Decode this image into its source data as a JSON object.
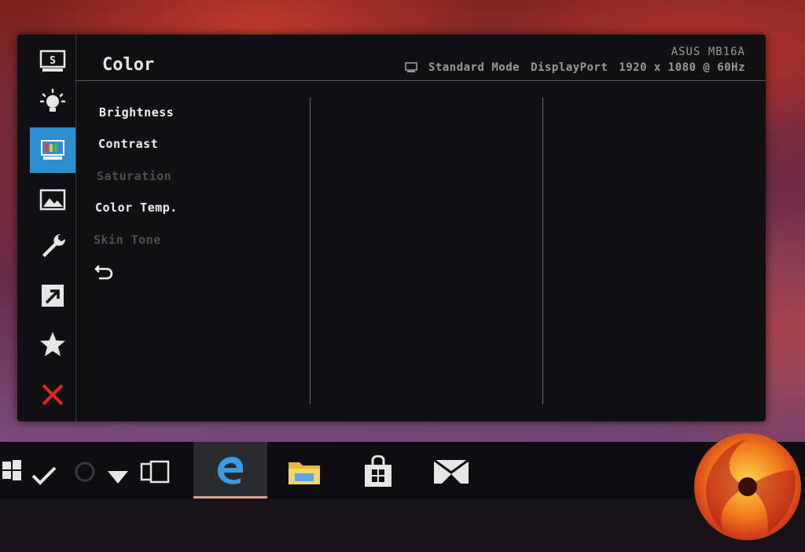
{
  "osd": {
    "title": "Color",
    "model": "ASUS MB16A",
    "mode": "Standard Mode",
    "input": "DisplayPort",
    "resolution": "1920 x 1080 @ 60Hz",
    "accent_color": "#2d8fd0",
    "sidebar": [
      {
        "name": "splendid-icon",
        "label": "S",
        "active": false
      },
      {
        "name": "blue-light-filter-icon",
        "active": false
      },
      {
        "name": "color-icon",
        "active": true
      },
      {
        "name": "image-icon",
        "active": false
      },
      {
        "name": "system-setup-icon",
        "active": false
      },
      {
        "name": "shortcut-icon",
        "active": false
      },
      {
        "name": "my-favorite-icon",
        "active": false
      },
      {
        "name": "exit-icon",
        "active": false
      }
    ],
    "menu": [
      {
        "label": "Brightness",
        "enabled": true
      },
      {
        "label": "Contrast",
        "enabled": true
      },
      {
        "label": "Saturation",
        "enabled": false
      },
      {
        "label": "Color Temp.",
        "enabled": true
      },
      {
        "label": "Skin Tone",
        "enabled": false
      }
    ],
    "back_icon": "return-arrow-icon"
  },
  "taskbar": {
    "items": [
      "windows-start-icon",
      "check-icon",
      "cortana-circle-icon",
      "down-triangle-icon",
      "task-view-icon",
      "edge-icon",
      "file-explorer-icon",
      "store-icon",
      "mail-icon"
    ],
    "active_item": "edge-icon"
  }
}
